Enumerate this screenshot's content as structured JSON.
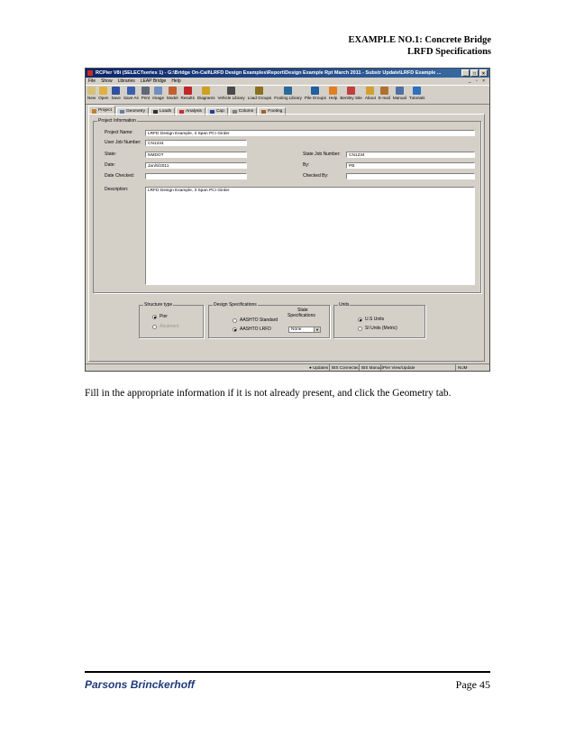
{
  "header": {
    "line1": "EXAMPLE NO.1: Concrete Bridge",
    "line2": "LRFD Specifications"
  },
  "window": {
    "title": "RCPier V8i (SELECTseries 1) - G:\\Bridge On-Call\\LRFD Design Examples\\Report\\Design Example Rpt March 2011 - Substr Update\\LRFD Example ...",
    "controls": [
      "_",
      "□",
      "×"
    ],
    "mdi_controls": "_ ▫ ×"
  },
  "menu": [
    "File",
    "Show",
    "Libraries",
    "LEAP Bridge",
    "Help"
  ],
  "toolbar": [
    {
      "label": "New",
      "color": "#d7c07a"
    },
    {
      "label": "Open",
      "color": "#e0b040"
    },
    {
      "label": "Save",
      "color": "#3050a0"
    },
    {
      "label": "Save As",
      "color": "#3a5fb0"
    },
    {
      "label": "Print",
      "color": "#606878"
    },
    {
      "label": "Image",
      "color": "#7090c0"
    },
    {
      "label": "Model",
      "color": "#c06030"
    },
    {
      "label": "Results",
      "color": "#c02828"
    },
    {
      "label": "Diagrams",
      "color": "#d0a020"
    },
    {
      "label": "Vehicle Library",
      "color": "#4a4a4a"
    },
    {
      "label": "Load Groups",
      "color": "#8a7020"
    },
    {
      "label": "Footing Library",
      "color": "#2a6a9a"
    },
    {
      "label": "Pile Groups",
      "color": "#2060a0"
    },
    {
      "label": "Help",
      "color": "#e08020"
    },
    {
      "label": "Bentley Site",
      "color": "#c04040"
    },
    {
      "label": "About",
      "color": "#d0a030"
    },
    {
      "label": "E-mail",
      "color": "#b07030"
    },
    {
      "label": "Manual",
      "color": "#5070a0"
    },
    {
      "label": "Tutorials",
      "color": "#2f6fbf"
    }
  ],
  "tabs": [
    {
      "label": "Project",
      "active": true,
      "color": "#c08030"
    },
    {
      "label": "Geometry",
      "active": false,
      "color": "#6080b0"
    },
    {
      "label": "Loads",
      "active": false,
      "color": "#303030"
    },
    {
      "label": "Analysis",
      "active": false,
      "color": "#c03030"
    },
    {
      "label": "Cap",
      "active": false,
      "color": "#2040a0"
    },
    {
      "label": "Column",
      "active": false,
      "color": "#808080"
    },
    {
      "label": "Footing",
      "active": false,
      "color": "#a06030"
    }
  ],
  "project_info": {
    "group_label": "Project Information",
    "project_name_label": "Project Name:",
    "project_name": "LRFD Design Example, 3 Span PCI Girder",
    "user_job_label": "User Job Number:",
    "user_job": "CN1234",
    "state_label": "State:",
    "state": "NMDOT",
    "state_job_label": "State Job Number:",
    "state_job": "CN1234",
    "date_label": "Date:",
    "date": "Jan/5/2011",
    "by_label": "By:",
    "by": "PB",
    "date_checked_label": "Date Checked:",
    "date_checked": "",
    "checked_by_label": "Checked By:",
    "checked_by": "",
    "description_label": "Description:",
    "description": "LRFD Design Example, 3 Span PCI Girder"
  },
  "structure_type": {
    "label": "Structure type",
    "pier": "Pier",
    "abutment": "Abutment"
  },
  "design_specs": {
    "label": "Design Specifications",
    "aashto_standard": "AASHTO Standard",
    "aashto_lrfd": "AASHTO LRFD",
    "state_specs_label_1": "State",
    "state_specs_label_2": "Specifications",
    "state_specs_value": "None"
  },
  "units": {
    "label": "Units",
    "us": "U.S Units",
    "si": "SI Units (Metric)"
  },
  "statusbar": {
    "updates": "Updates",
    "ibs": "IBS Connected",
    "manual": "IBS Manual",
    "mode": "Pier View/Update",
    "num": "NUM"
  },
  "caption": "Fill in the appropriate information if it is not already present, and click the Geometry tab.",
  "footer": {
    "company": "Parsons Brinckerhoff",
    "page": "Page 45"
  }
}
